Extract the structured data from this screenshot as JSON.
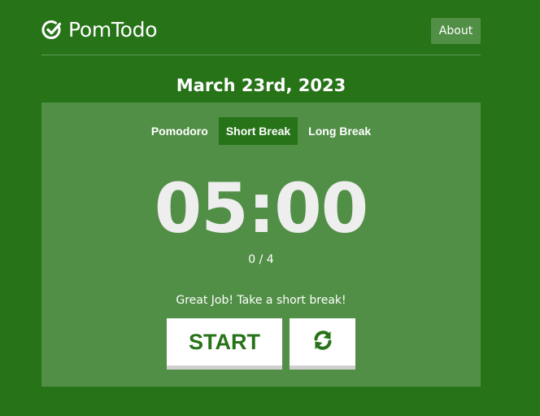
{
  "header": {
    "app_name": "PomTodo",
    "about_label": "About"
  },
  "date": "March 23rd, 2023",
  "tabs": [
    {
      "label": "Pomodoro",
      "active": false
    },
    {
      "label": "Short Break",
      "active": true
    },
    {
      "label": "Long Break",
      "active": false
    }
  ],
  "timer": {
    "display": "05:00",
    "count": "0 / 4",
    "message": "Great Job! Take a short break!"
  },
  "controls": {
    "start_label": "START",
    "reset_icon": "refresh-icon"
  },
  "colors": {
    "background": "#267318",
    "active_tab": "#267318",
    "button_bg": "#ffffff",
    "button_text": "#267318"
  }
}
